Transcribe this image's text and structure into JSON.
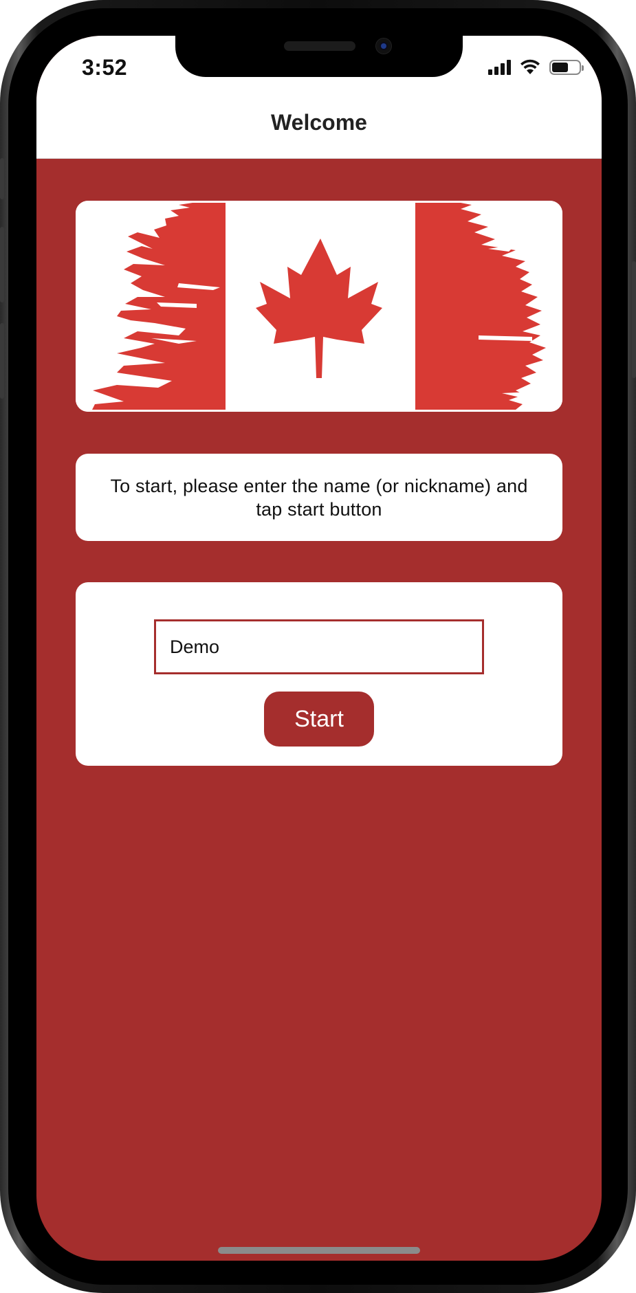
{
  "status_bar": {
    "time": "3:52",
    "signal_icon": "cellular-signal-icon",
    "wifi_icon": "wifi-icon",
    "battery_icon": "battery-icon",
    "battery_level": 0.6
  },
  "nav": {
    "title": "Welcome"
  },
  "flag": {
    "icon": "canada-flag-image",
    "colors": {
      "red": "#d83a34",
      "white": "#ffffff"
    }
  },
  "info": {
    "text": "To start, please enter the name (or nickname) and tap start button"
  },
  "form": {
    "name_value": "Demo",
    "start_label": "Start"
  },
  "colors": {
    "background": "#a52e2d",
    "accent": "#a52e2d",
    "card": "#ffffff"
  }
}
